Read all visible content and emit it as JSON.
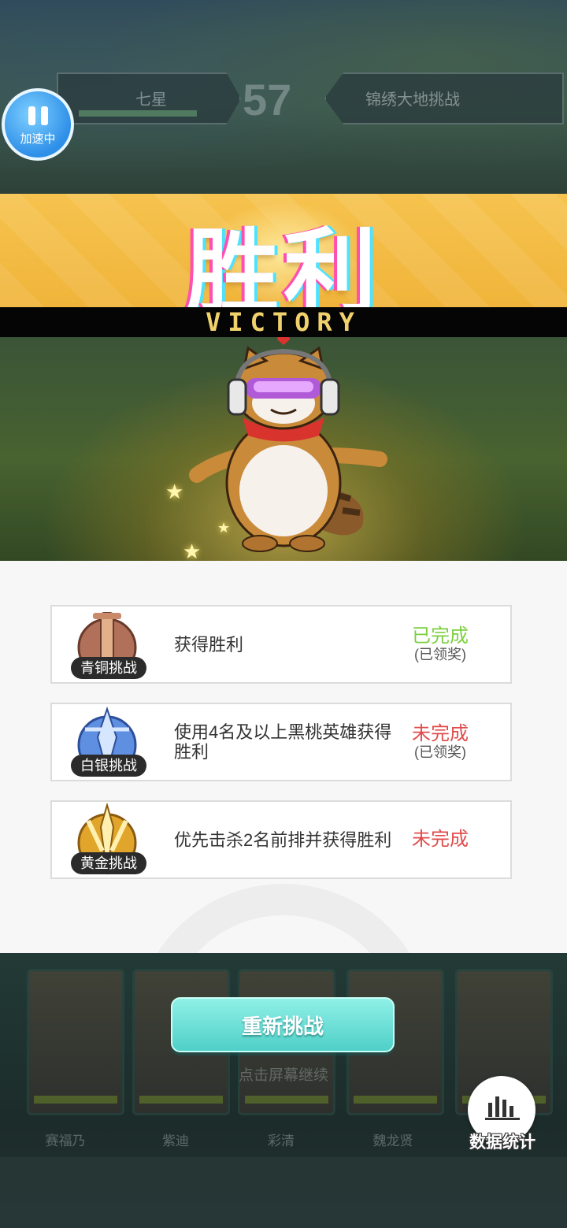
{
  "hud": {
    "left_name": "七星",
    "score": "57",
    "right_name": "锦绣大地挑战"
  },
  "speed_button": {
    "label": "加速中",
    "icon": "pause-icon"
  },
  "banner": {
    "title": "胜利",
    "subtitle": "VICTORY"
  },
  "hero": {
    "icon": "raccoon-hero"
  },
  "challenges": [
    {
      "tier": "青铜挑战",
      "medal_color": "#b0705a",
      "description": "获得胜利",
      "status": "已完成",
      "status_color": "#7ccf3f",
      "reward_note": "(已领奖)"
    },
    {
      "tier": "白银挑战",
      "medal_color": "#5f8fe0",
      "description": "使用4名及以上黑桃英雄获得胜利",
      "status": "未完成",
      "status_color": "#e04b4b",
      "reward_note": "(已领奖)"
    },
    {
      "tier": "黄金挑战",
      "medal_color": "#e0a52a",
      "description": "优先击杀2名前排并获得胜利",
      "status": "未完成",
      "status_color": "#e04b4b",
      "reward_note": ""
    }
  ],
  "hero_cards": [
    {
      "name": "赛福乃"
    },
    {
      "name": "紫迪"
    },
    {
      "name": "彩清"
    },
    {
      "name": "魏龙贤"
    },
    {
      "name": ""
    }
  ],
  "retry_button": {
    "label": "重新挑战"
  },
  "tap_hint": "点击屏幕继续",
  "stats_button": {
    "label": "数据统计",
    "icon": "bar-chart-icon"
  }
}
